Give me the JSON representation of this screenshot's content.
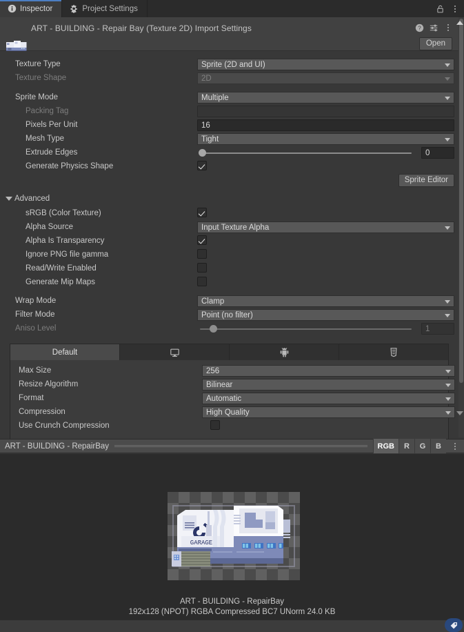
{
  "window": {
    "tabs": [
      {
        "label": "Inspector",
        "icon": "info-icon",
        "active": true
      },
      {
        "label": "Project Settings",
        "icon": "gear-icon",
        "active": false
      }
    ],
    "lock_icon": "lock-open-icon",
    "menu_icon": "kebab-menu-icon"
  },
  "component_header": {
    "title": "ART - BUILDING - Repair Bay (Texture 2D) Import Settings",
    "thumbnail": "texture-thumbnail",
    "help_icon": "help-icon",
    "preset_icon": "preset-icon",
    "menu_icon": "kebab-menu-icon",
    "open_label": "Open"
  },
  "properties": {
    "texture_type": {
      "label": "Texture Type",
      "value": "Sprite (2D and UI)"
    },
    "texture_shape": {
      "label": "Texture Shape",
      "value": "2D"
    },
    "sprite_mode": {
      "label": "Sprite Mode",
      "value": "Multiple"
    },
    "packing_tag": {
      "label": "Packing Tag",
      "value": ""
    },
    "pixels_per_unit": {
      "label": "Pixels Per Unit",
      "value": "16"
    },
    "mesh_type": {
      "label": "Mesh Type",
      "value": "Tight"
    },
    "extrude_edges": {
      "label": "Extrude Edges",
      "value": "0"
    },
    "generate_physics_shape": {
      "label": "Generate Physics Shape",
      "checked": true
    },
    "sprite_editor_button": "Sprite Editor"
  },
  "advanced": {
    "title": "Advanced",
    "srgb": {
      "label": "sRGB (Color Texture)",
      "checked": true
    },
    "alpha_source": {
      "label": "Alpha Source",
      "value": "Input Texture Alpha"
    },
    "alpha_is_transparency": {
      "label": "Alpha Is Transparency",
      "checked": true
    },
    "ignore_png_gamma": {
      "label": "Ignore PNG file gamma",
      "checked": false
    },
    "read_write_enabled": {
      "label": "Read/Write Enabled",
      "checked": false
    },
    "generate_mip_maps": {
      "label": "Generate Mip Maps",
      "checked": false
    }
  },
  "filtering": {
    "wrap_mode": {
      "label": "Wrap Mode",
      "value": "Clamp"
    },
    "filter_mode": {
      "label": "Filter Mode",
      "value": "Point (no filter)"
    },
    "aniso_level": {
      "label": "Aniso Level",
      "value": "1"
    }
  },
  "platform": {
    "tabs": [
      {
        "label": "Default",
        "icon": "",
        "active": true
      },
      {
        "label": "",
        "icon": "standalone-monitor-icon",
        "active": false
      },
      {
        "label": "",
        "icon": "android-robot-icon",
        "active": false
      },
      {
        "label": "",
        "icon": "webgl-html5-icon",
        "active": false
      }
    ],
    "max_size": {
      "label": "Max Size",
      "value": "256"
    },
    "resize_algorithm": {
      "label": "Resize Algorithm",
      "value": "Bilinear"
    },
    "format": {
      "label": "Format",
      "value": "Automatic"
    },
    "compression": {
      "label": "Compression",
      "value": "High Quality"
    },
    "use_crunch_compression": {
      "label": "Use Crunch Compression",
      "checked": false
    }
  },
  "preview": {
    "title": "ART - BUILDING - RepairBay",
    "channels": [
      {
        "label": "RGB",
        "active": true
      },
      {
        "label": "R",
        "active": false
      },
      {
        "label": "G",
        "active": false
      },
      {
        "label": "B",
        "active": false
      }
    ],
    "menu_icon": "kebab-menu-icon",
    "caption_name": "ART - BUILDING - RepairBay",
    "caption_info": "192x128 (NPOT)  RGBA Compressed BC7 UNorm   24.0 KB"
  },
  "colors": {
    "accent": "#4b7ec2",
    "panel": "#383838",
    "header": "#414141",
    "field": "#585858",
    "text": "#c9c9c9",
    "text_dim": "#7d7d7d"
  }
}
